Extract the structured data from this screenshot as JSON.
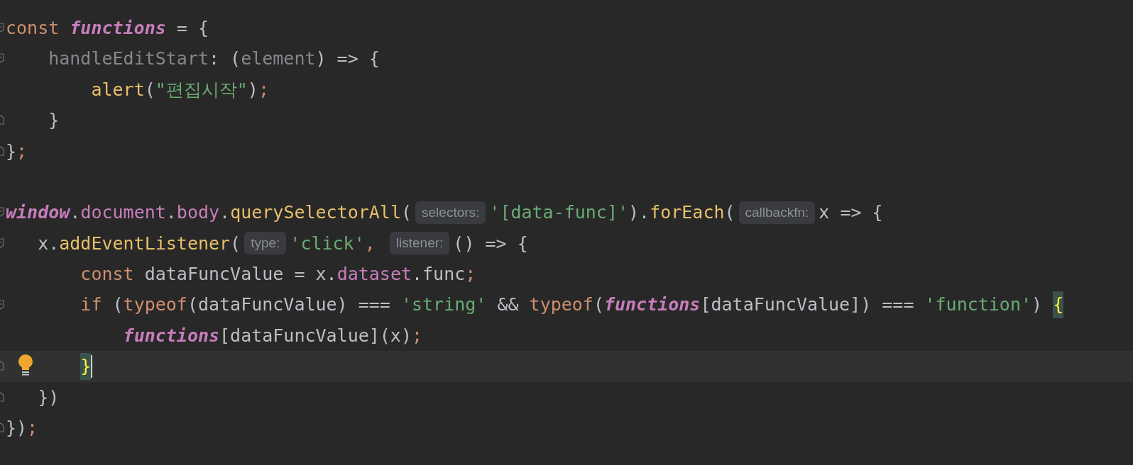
{
  "editor": {
    "lines": [
      {
        "fold_start": true,
        "tokens": [
          {
            "kind": "keyword",
            "text": "const "
          },
          {
            "kind": "global",
            "text": "functions"
          },
          {
            "kind": "plain",
            "text": " = {"
          }
        ]
      },
      {
        "fold_start": true,
        "tokens": [
          {
            "kind": "unused",
            "text": "    handleEditStart"
          },
          {
            "kind": "plain",
            "text": ": ("
          },
          {
            "kind": "unused",
            "text": "element"
          },
          {
            "kind": "plain",
            "text": ") => {"
          }
        ]
      },
      {
        "tokens": [
          {
            "kind": "call",
            "text": "        alert"
          },
          {
            "kind": "plain",
            "text": "("
          },
          {
            "kind": "string",
            "text": "\"편집시작\""
          },
          {
            "kind": "plain",
            "text": ")"
          },
          {
            "kind": "keyword",
            "text": ";"
          }
        ]
      },
      {
        "fold_end": true,
        "tokens": [
          {
            "kind": "plain",
            "text": "    }"
          }
        ]
      },
      {
        "fold_end": true,
        "tokens": [
          {
            "kind": "plain",
            "text": "}"
          },
          {
            "kind": "keyword",
            "text": ";"
          }
        ]
      },
      {
        "blank": true
      },
      {
        "fold_start": true,
        "tokens": [
          {
            "kind": "global",
            "text": "window"
          },
          {
            "kind": "plain",
            "text": "."
          },
          {
            "kind": "field",
            "text": "document"
          },
          {
            "kind": "plain",
            "text": "."
          },
          {
            "kind": "field",
            "text": "body"
          },
          {
            "kind": "plain",
            "text": "."
          },
          {
            "kind": "call",
            "text": "querySelectorAll"
          },
          {
            "kind": "plain",
            "text": "("
          },
          {
            "kind": "hint",
            "text": "selectors:"
          },
          {
            "kind": "string",
            "text": "'[data-func]'"
          },
          {
            "kind": "plain",
            "text": ")."
          },
          {
            "kind": "call",
            "text": "forEach"
          },
          {
            "kind": "plain",
            "text": "("
          },
          {
            "kind": "hint",
            "text": "callbackfn:"
          },
          {
            "kind": "plain",
            "text": "x => {"
          }
        ]
      },
      {
        "fold_start": true,
        "tokens": [
          {
            "kind": "plain",
            "text": "   x."
          },
          {
            "kind": "call",
            "text": "addEventListener"
          },
          {
            "kind": "plain",
            "text": "("
          },
          {
            "kind": "hint",
            "text": "type:"
          },
          {
            "kind": "string",
            "text": "'click'"
          },
          {
            "kind": "keyword",
            "text": ", "
          },
          {
            "kind": "hint",
            "text": "listener:"
          },
          {
            "kind": "plain",
            "text": "() => {"
          }
        ]
      },
      {
        "tokens": [
          {
            "kind": "keyword",
            "text": "       const"
          },
          {
            "kind": "plain",
            "text": " dataFuncValue = x."
          },
          {
            "kind": "field",
            "text": "dataset"
          },
          {
            "kind": "plain",
            "text": ".func"
          },
          {
            "kind": "keyword",
            "text": ";"
          }
        ]
      },
      {
        "fold_start": true,
        "tokens": [
          {
            "kind": "keyword",
            "text": "       if"
          },
          {
            "kind": "plain",
            "text": " ("
          },
          {
            "kind": "keyword",
            "text": "typeof"
          },
          {
            "kind": "plain",
            "text": "(dataFuncValue) === "
          },
          {
            "kind": "string",
            "text": "'string'"
          },
          {
            "kind": "plain",
            "text": " && "
          },
          {
            "kind": "keyword",
            "text": "typeof"
          },
          {
            "kind": "plain",
            "text": "("
          },
          {
            "kind": "global",
            "text": "functions"
          },
          {
            "kind": "plain",
            "text": "[dataFuncValue]) === "
          },
          {
            "kind": "string",
            "text": "'function'"
          },
          {
            "kind": "plain",
            "text": ") "
          },
          {
            "kind": "match",
            "text": "{"
          }
        ]
      },
      {
        "tokens": [
          {
            "kind": "global",
            "text": "           functions"
          },
          {
            "kind": "plain",
            "text": "[dataFuncValue](x)"
          },
          {
            "kind": "keyword",
            "text": ";"
          }
        ]
      },
      {
        "fold_end": true,
        "current": true,
        "bulb": true,
        "caret": true,
        "tokens": [
          {
            "kind": "match",
            "text": "       }"
          }
        ]
      },
      {
        "fold_end": true,
        "tokens": [
          {
            "kind": "plain",
            "text": "   })"
          }
        ]
      },
      {
        "fold_end": true,
        "tokens": [
          {
            "kind": "plain",
            "text": "})"
          },
          {
            "kind": "keyword",
            "text": ";"
          }
        ]
      }
    ]
  }
}
